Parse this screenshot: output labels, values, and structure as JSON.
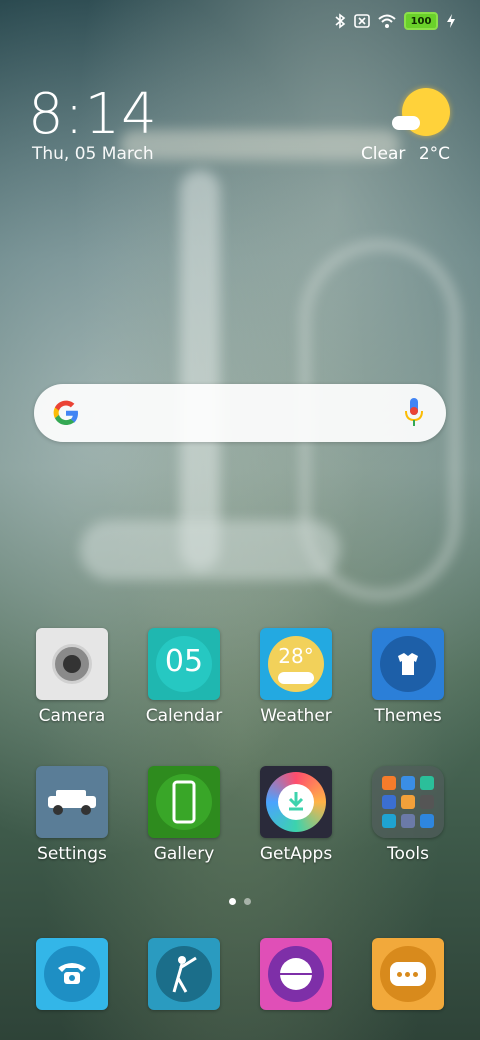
{
  "status": {
    "battery": "100",
    "icons": [
      "bluetooth-icon",
      "sim-off-icon",
      "wifi-icon",
      "battery-icon",
      "charging-icon"
    ]
  },
  "lockscreen": {
    "time": "8:14",
    "date": "Thu, 05 March"
  },
  "weather": {
    "condition": "Clear",
    "temperature": "2°C"
  },
  "search": {
    "placeholder": ""
  },
  "apps_row1": [
    {
      "label": "Camera"
    },
    {
      "label": "Calendar",
      "icon_text": "05"
    },
    {
      "label": "Weather",
      "icon_text": "28°"
    },
    {
      "label": "Themes"
    }
  ],
  "apps_row2": [
    {
      "label": "Settings"
    },
    {
      "label": "Gallery"
    },
    {
      "label": "GetApps"
    },
    {
      "label": "Tools"
    }
  ],
  "dock": [
    {
      "name": "phone"
    },
    {
      "name": "cricket"
    },
    {
      "name": "cricket-ball"
    },
    {
      "name": "messaging"
    }
  ],
  "pages": {
    "count": 2,
    "active": 1
  }
}
